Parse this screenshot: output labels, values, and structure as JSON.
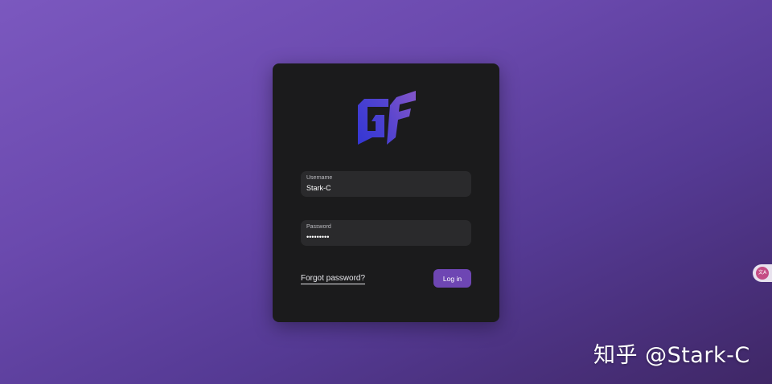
{
  "login": {
    "logo_icon": "gf-logo-icon",
    "username": {
      "label": "Username",
      "value": "Stark-C"
    },
    "password": {
      "label": "Password",
      "value": "•••••••••"
    },
    "forgot_link": "Forgot password?",
    "login_button": "Log in"
  },
  "side_tab": {
    "icon": "translate-icon",
    "label": "文A"
  },
  "watermark": {
    "text": "知乎 @Stark-C"
  },
  "colors": {
    "background_start": "#7b58bf",
    "background_end": "#3f2766",
    "card": "#1b1b1c",
    "field": "#2a2a2c",
    "accent": "#6e46b3",
    "logo_blue": "#3b3fd6",
    "logo_purple": "#7a4fc8"
  }
}
